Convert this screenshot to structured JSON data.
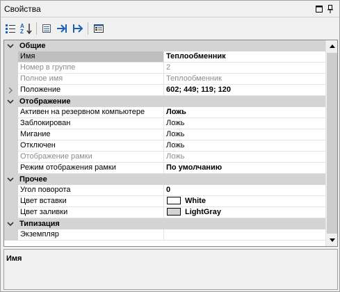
{
  "window": {
    "title": "Свойства"
  },
  "icons": {
    "titlebar": [
      "window-menu-icon",
      "pin-icon"
    ],
    "toolbar": [
      "categorized-icon",
      "sort-alphabetical-icon",
      "property-pages-icon",
      "go-to-definition-icon",
      "go-to-next-icon",
      "events-icon"
    ]
  },
  "grid": {
    "rows": [
      {
        "type": "category",
        "label": "Общие",
        "expanded": true
      },
      {
        "type": "property",
        "name": "Имя",
        "value": "Теплообменник",
        "bold": true,
        "selected": true
      },
      {
        "type": "property",
        "name": "Номер в группе",
        "value": "2",
        "readonly": true
      },
      {
        "type": "property",
        "name": "Полное имя",
        "value": "Теплообменник",
        "readonly": true
      },
      {
        "type": "property",
        "name": "Положение",
        "value": "602; 449; 119; 120",
        "bold": true,
        "expandable": true
      },
      {
        "type": "category",
        "label": "Отображение",
        "expanded": true
      },
      {
        "type": "property",
        "name": "Активен на резервном компьютере",
        "value": "Ложь",
        "bold": true
      },
      {
        "type": "property",
        "name": "Заблокирован",
        "value": "Ложь"
      },
      {
        "type": "property",
        "name": "Мигание",
        "value": "Ложь"
      },
      {
        "type": "property",
        "name": "Отключен",
        "value": "Ложь"
      },
      {
        "type": "property",
        "name": "Отображение рамки",
        "value": "Ложь",
        "readonly": true
      },
      {
        "type": "property",
        "name": "Режим отображения рамки",
        "value": "По умолчанию",
        "bold": true
      },
      {
        "type": "category",
        "label": "Прочее",
        "expanded": true
      },
      {
        "type": "property",
        "name": "Угол поворота",
        "value": "0",
        "bold": true
      },
      {
        "type": "property",
        "name": "Цвет вставки",
        "value": "White",
        "bold": true,
        "color": "#ffffff"
      },
      {
        "type": "property",
        "name": "Цвет заливки",
        "value": "LightGray",
        "bold": true,
        "color": "#d3d3d3"
      },
      {
        "type": "category",
        "label": "Типизация",
        "expanded": true
      },
      {
        "type": "property",
        "name": "Экземпляр",
        "value": ""
      }
    ]
  },
  "description": {
    "title": "Имя"
  },
  "colors": {
    "category_bg": "#d4d4d4",
    "readonly_text": "#8c8c8c",
    "selected_bg": "#bfbfbf"
  }
}
